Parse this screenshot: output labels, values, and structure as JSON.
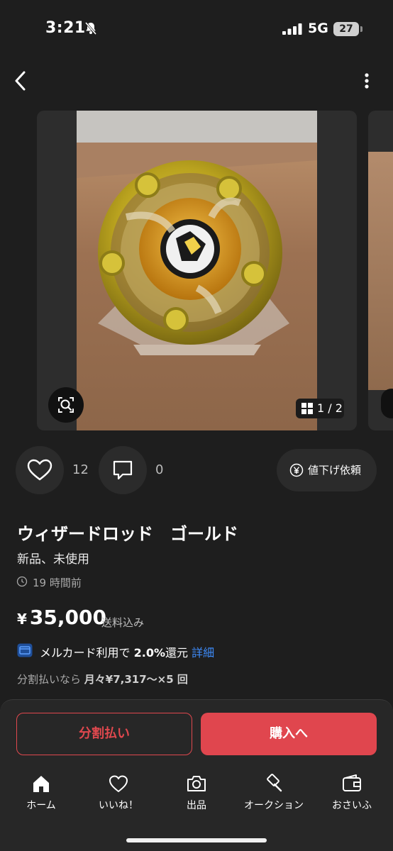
{
  "status": {
    "time": "3:21",
    "network": "5G",
    "battery": "27"
  },
  "gallery": {
    "counter": "1 / 2"
  },
  "actions": {
    "like_count": "12",
    "comment_count": "0",
    "price_request_label": "値下げ依頼"
  },
  "item": {
    "title": "ウィザードロッド　ゴールド",
    "condition": "新品、未使用",
    "posted": "19 時間前",
    "price_symbol": "¥",
    "price": "35,000",
    "shipping": "送料込み"
  },
  "cashback": {
    "prefix": "メルカード利用で",
    "rate": "2.0%",
    "suffix": "還元",
    "link": "詳細"
  },
  "installment": {
    "prefix": "分割払いなら",
    "amount": "月々¥7,317〜×5 回"
  },
  "buttons": {
    "installment": "分割払い",
    "buy": "購入へ"
  },
  "tabs": [
    {
      "label": "ホーム",
      "icon": "home-icon"
    },
    {
      "label": "いいね！",
      "icon": "heart-icon"
    },
    {
      "label": "出品",
      "icon": "camera-icon"
    },
    {
      "label": "オークション",
      "icon": "gavel-icon"
    },
    {
      "label": "おさいふ",
      "icon": "wallet-icon"
    }
  ],
  "colors": {
    "accent": "#e0464e",
    "link": "#3d8af7",
    "background": "#1e1e1e"
  }
}
